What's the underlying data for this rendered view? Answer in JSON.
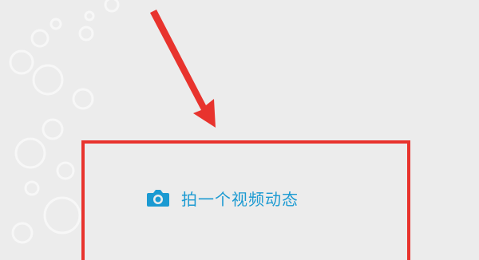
{
  "post_action": {
    "label": "拍一个视频动态",
    "icon": "camera-icon",
    "color": "#1b9ad2"
  },
  "annotation": {
    "box_color": "#e8332d",
    "arrow_color": "#e8332d"
  }
}
